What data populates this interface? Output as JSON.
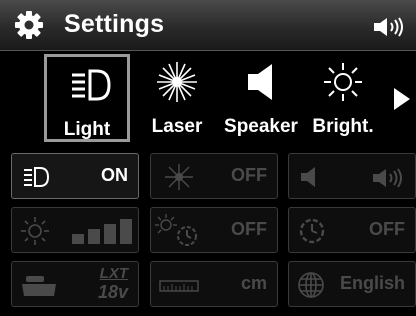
{
  "header": {
    "title": "Settings",
    "icon": "gear-icon",
    "volume_icon": "speaker-volume-icon"
  },
  "tabs": [
    {
      "label": "Light",
      "icon": "headlight-icon",
      "selected": true
    },
    {
      "label": "Laser",
      "icon": "laser-burst-icon",
      "selected": false
    },
    {
      "label": "Speaker",
      "icon": "speaker-icon",
      "selected": false
    },
    {
      "label": "Bright.",
      "icon": "sun-icon",
      "selected": false
    }
  ],
  "next_icon": "right-arrow-icon",
  "grid": {
    "row1": [
      {
        "icon": "headlight-icon",
        "value": "ON",
        "active": true
      },
      {
        "icon": "laser-burst-icon",
        "value": "OFF",
        "active": false
      },
      {
        "icon": "speaker-volume-icon",
        "value": "",
        "active": false
      }
    ],
    "row2": [
      {
        "icon": "brightness-level-icon",
        "value": "",
        "active": false
      },
      {
        "icon": "sun-timer-icon",
        "value": "OFF",
        "active": false
      },
      {
        "icon": "timer-icon",
        "value": "OFF",
        "active": false
      }
    ],
    "row3": [
      {
        "icon": "battery-icon",
        "brand": "LXT",
        "voltage": "18v",
        "active": false
      },
      {
        "icon": "ruler-icon",
        "value": "cm",
        "active": false
      },
      {
        "icon": "globe-icon",
        "value": "English",
        "active": false
      }
    ]
  },
  "colors": {
    "header_top": "#4a4a4a",
    "header_bottom": "#1a1a1a",
    "selected_border": "#9a9a9a",
    "inactive_text": "#4a4a4a"
  }
}
